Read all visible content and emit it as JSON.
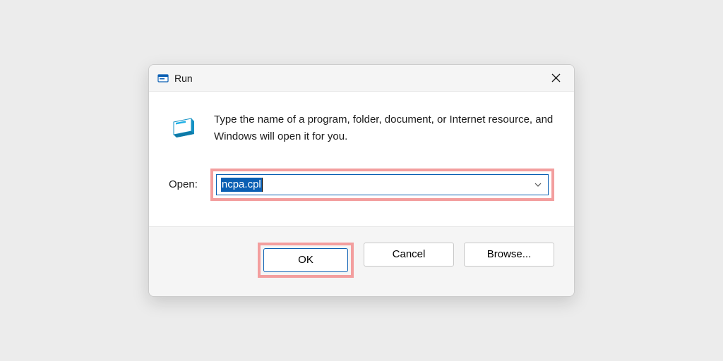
{
  "dialog": {
    "title": "Run",
    "description": "Type the name of a program, folder, document, or Internet resource, and Windows will open it for you.",
    "open_label": "Open:",
    "input_value": "ncpa.cpl",
    "buttons": {
      "ok": "OK",
      "cancel": "Cancel",
      "browse": "Browse..."
    }
  },
  "colors": {
    "highlight": "#f39e9e",
    "accent": "#0a5fb3"
  }
}
